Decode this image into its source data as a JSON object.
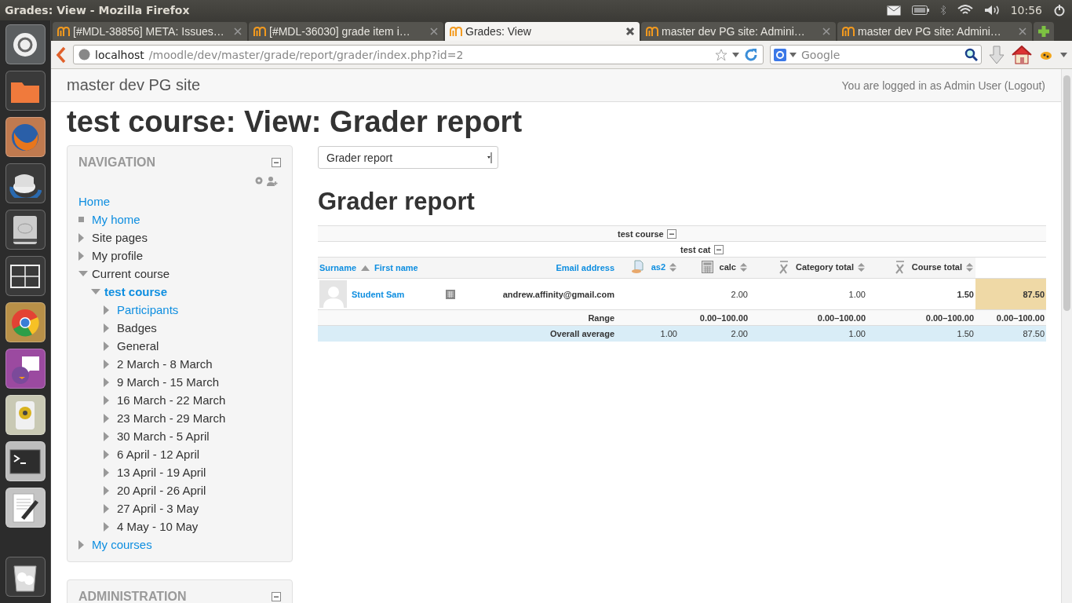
{
  "window": {
    "title": "Grades: View - Mozilla Firefox"
  },
  "system_tray": {
    "time": "10:56"
  },
  "tabs": [
    {
      "label": "[#MDL-38856] META: Issues…",
      "selected": false
    },
    {
      "label": "[#MDL-36030] grade item i…",
      "selected": false
    },
    {
      "label": "Grades: View",
      "selected": true
    },
    {
      "label": "master dev PG site: Admini…",
      "selected": false
    },
    {
      "label": "master dev PG site: Admini…",
      "selected": false
    }
  ],
  "address_bar": {
    "host": "localhost",
    "path": "/moodle/dev/master/grade/report/grader/index.php?id=2"
  },
  "search": {
    "placeholder": "Google"
  },
  "site": {
    "name": "master dev PG site",
    "login_text": "You are logged in as Admin User",
    "logout": "(Logout)"
  },
  "page_title": "test course: View: Grader report",
  "navigation": {
    "title": "NAVIGATION",
    "items": [
      {
        "label": "Home",
        "kind": "root",
        "link": true
      },
      {
        "label": "My home",
        "kind": "leaf",
        "link": true
      },
      {
        "label": "Site pages",
        "kind": "branch",
        "link": false,
        "expanded": false
      },
      {
        "label": "My profile",
        "kind": "branch",
        "link": false,
        "expanded": false
      },
      {
        "label": "Current course",
        "kind": "branch",
        "link": false,
        "expanded": true,
        "children": [
          {
            "label": "test course",
            "kind": "branch",
            "link": true,
            "active": true,
            "expanded": true,
            "children": [
              {
                "label": "Participants",
                "kind": "branch",
                "link": true,
                "expanded": false
              },
              {
                "label": "Badges",
                "kind": "branch",
                "link": false,
                "expanded": false
              },
              {
                "label": "General",
                "kind": "branch",
                "link": false,
                "expanded": false
              },
              {
                "label": "2 March - 8 March",
                "kind": "branch",
                "link": false,
                "expanded": false
              },
              {
                "label": "9 March - 15 March",
                "kind": "branch",
                "link": false,
                "expanded": false
              },
              {
                "label": "16 March - 22 March",
                "kind": "branch",
                "link": false,
                "expanded": false
              },
              {
                "label": "23 March - 29 March",
                "kind": "branch",
                "link": false,
                "expanded": false
              },
              {
                "label": "30 March - 5 April",
                "kind": "branch",
                "link": false,
                "expanded": false
              },
              {
                "label": "6 April - 12 April",
                "kind": "branch",
                "link": false,
                "expanded": false
              },
              {
                "label": "13 April - 19 April",
                "kind": "branch",
                "link": false,
                "expanded": false
              },
              {
                "label": "20 April - 26 April",
                "kind": "branch",
                "link": false,
                "expanded": false
              },
              {
                "label": "27 April - 3 May",
                "kind": "branch",
                "link": false,
                "expanded": false
              },
              {
                "label": "4 May - 10 May",
                "kind": "branch",
                "link": false,
                "expanded": false
              }
            ]
          }
        ]
      },
      {
        "label": "My courses",
        "kind": "branch",
        "link": true,
        "expanded": false
      }
    ]
  },
  "administration": {
    "title": "ADMINISTRATION"
  },
  "report_select": {
    "value": "Grader report"
  },
  "report_heading": "Grader report",
  "grader": {
    "course_category": "test course",
    "sub_category": "test cat",
    "name_headers": [
      {
        "label": "Surname",
        "sorted": true
      },
      {
        "label": "First name",
        "sorted": false
      }
    ],
    "email_header": "Email address",
    "item_headers": [
      {
        "label": "as2",
        "kind": "assignment"
      },
      {
        "label": "calc",
        "kind": "calculated"
      },
      {
        "label": "Category total",
        "kind": "total"
      },
      {
        "label": "Course total",
        "kind": "total"
      }
    ],
    "students": [
      {
        "name": "Student Sam",
        "email": "andrew.affinity@gmail.com",
        "cells": [
          {},
          {
            "value": "2.00",
            "bold": false
          },
          {
            "value": "1.00",
            "bold": false
          },
          {
            "value": "1.50",
            "bold": true
          },
          {
            "value": "87.50",
            "bold": true,
            "highlighted": true
          }
        ]
      }
    ],
    "summary_rows": [
      {
        "label": "Range",
        "kind": "range",
        "cells": [
          {},
          {
            "value": "0.00–100.00"
          },
          {
            "value": "0.00–100.00"
          },
          {
            "value": "0.00–100.00"
          },
          {
            "value": "0.00–100.00"
          }
        ]
      },
      {
        "label": "Overall average",
        "kind": "average",
        "cells": [
          {
            "value": "1.00"
          },
          {
            "value": "2.00"
          },
          {
            "value": "1.00"
          },
          {
            "value": "1.50"
          },
          {
            "value": "87.50"
          }
        ]
      }
    ]
  }
}
